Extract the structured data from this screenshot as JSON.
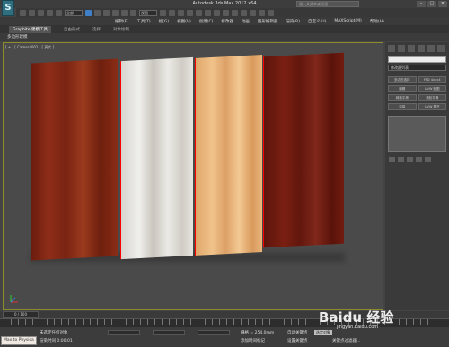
{
  "window": {
    "title": "Autodesk 3ds Max 2012 x64     ",
    "help_placeholder": "键入关键字或短语",
    "logo_text": "S"
  },
  "toolbar": {
    "selection_filter": "全部",
    "view_select": "视图"
  },
  "menubar": {
    "items": [
      "编辑(E)",
      "工具(T)",
      "组(G)",
      "视图(V)",
      "创建(C)",
      "修改器",
      "动画",
      "图形编辑器",
      "渲染(R)",
      "自定义(U)",
      "MAXScript(M)",
      "帮助(H)"
    ]
  },
  "ribbon": {
    "tabs": [
      "Graphite 建模工具",
      "自由形式",
      "选择",
      "对象绘制"
    ],
    "active_tab": "Graphite 建模工具",
    "sub_label": "多边形建模"
  },
  "viewport": {
    "label": "[ + ] [ Camera001 ] [ 真实 ]"
  },
  "command_panel": {
    "dropdown": "修改器列表",
    "buttons": [
      "多边形选择",
      "FFD 4x4x4",
      "编辑",
      "UVW 贴图",
      "网格平滑",
      "涡轮平滑",
      "选择",
      "UVW 展开"
    ]
  },
  "timeline": {
    "frame_counter": "0 / 100"
  },
  "status": {
    "maxscript": "Max to Physica",
    "line1": "未选定任何对象",
    "line2": "渲染时间 0:00:01",
    "grid": "栅格 = 254.0mm",
    "autokey": "自动关键点",
    "selected": "选定对象",
    "setkey": "设置关键点",
    "keyfilter": "关键点过滤器...",
    "add_time_tag": "添加时间标记"
  },
  "watermark": {
    "brand": "Baidu 经验",
    "url": "jingyan.baidu.com"
  },
  "colors": {
    "viewport_border": "#8c8c2c",
    "active_blue": "#3f7fc8"
  }
}
